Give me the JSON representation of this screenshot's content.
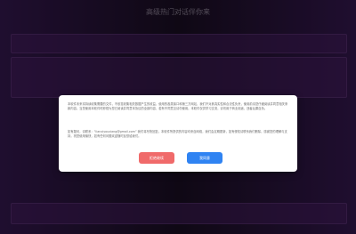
{
  "header": {
    "title": "高级热门对话伴你来"
  },
  "dialog": {
    "paragraphs": [
      "本软件未来将持续收集需要的文件，不依靠收集相关数据产生的收益，使用的各类接口和第三方网站，我们不对其真实性和合法性负责，使用前请您仔细阅读并同意相关条款内容。当您使用本软件时即视为您已阅读并同意本协议的全部内容，若有不同意见请勿使用。本软件仅供学习交流，请勿用于商业用途，违者后果自负。",
      "如有疑问，请联系：“lianxiyouxiang@gmail.com” 我们将尽快回复。本软件所提供的内容均来自网络，我们会定期更新，如有侵权请联系我们删除。感谢您的理解与支持，祝您使用愉快，如有任何问题欢迎随时反馈给我们。"
    ],
    "buttons": {
      "reject": "拒绝继续",
      "agree": "我同意"
    }
  },
  "colors": {
    "reject": "#f06a6a",
    "agree": "#2f83f2"
  }
}
